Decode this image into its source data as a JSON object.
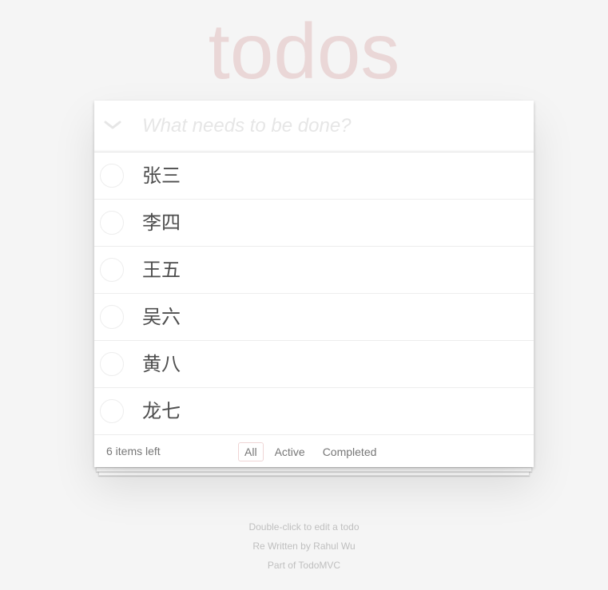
{
  "app": {
    "title": "todos"
  },
  "header": {
    "toggle_all_icon": "chevron-down-icon",
    "new_todo_placeholder": "What needs to be done?",
    "new_todo_value": ""
  },
  "todos": [
    {
      "label": "张三",
      "completed": false
    },
    {
      "label": "李四",
      "completed": false
    },
    {
      "label": "王五",
      "completed": false
    },
    {
      "label": "吴六",
      "completed": false
    },
    {
      "label": "黄八",
      "completed": false
    },
    {
      "label": "龙七",
      "completed": false
    }
  ],
  "footer": {
    "count_text": "6 items left",
    "filters": [
      {
        "label": "All",
        "selected": true
      },
      {
        "label": "Active",
        "selected": false
      },
      {
        "label": "Completed",
        "selected": false
      }
    ]
  },
  "info": {
    "line1": "Double-click to edit a todo",
    "line2": "Re Written by Rahul Wu",
    "line3": "Part of TodoMVC"
  },
  "colors": {
    "title": "#e6d0d0",
    "background": "#f5f5f5",
    "text": "#4d4d4d",
    "selected_filter_border": "#efd5d5"
  }
}
